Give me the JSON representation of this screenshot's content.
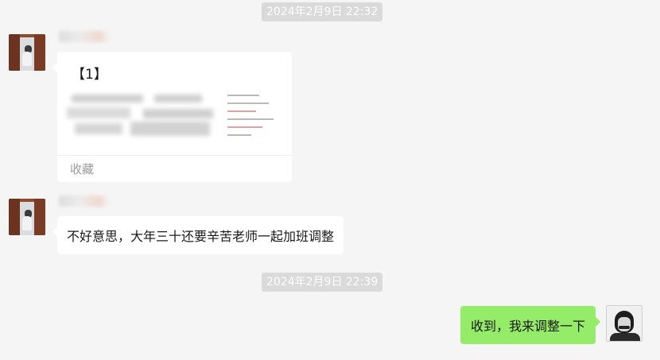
{
  "timestamps": [
    "2024年2月9日 22:32",
    "2024年2月9日 22:39"
  ],
  "sender_name_first_char": "居",
  "messages": [
    {
      "type": "favorite-card",
      "title": "【1】",
      "footer": "收藏"
    },
    {
      "type": "text",
      "text": "不好意思，大年三十还要辛苦老师一起加班调整"
    },
    {
      "type": "text",
      "text": "收到，我来调整一下"
    }
  ],
  "colors": {
    "background": "#f5f5f5",
    "timestamp_bg": "#dadada",
    "bubble_in": "#ffffff",
    "bubble_out": "#95ec69"
  },
  "icons": {
    "sender_avatar": "door-cat-avatar",
    "self_avatar": "portrait-avatar"
  }
}
